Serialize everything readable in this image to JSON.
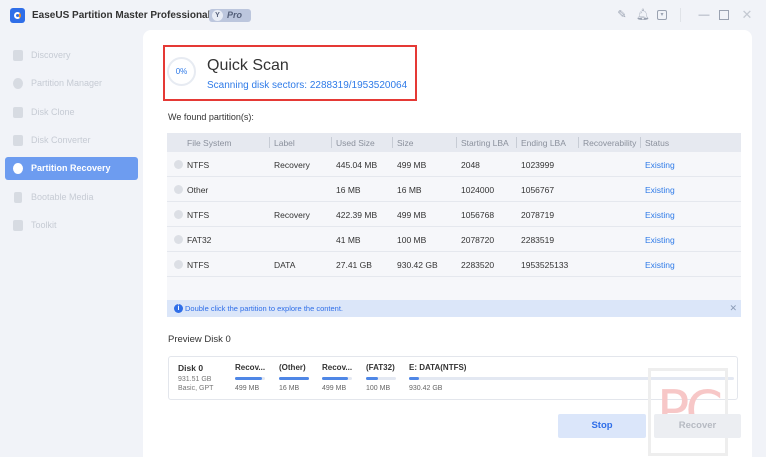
{
  "app": {
    "title": "EaseUS Partition Master Professional Edition",
    "badge": "Pro"
  },
  "titlebar_icons": [
    "feedback-icon",
    "bell-icon",
    "download-icon",
    "minimize-icon",
    "maximize-icon",
    "close-icon"
  ],
  "sidebar": {
    "items": [
      {
        "label": "Discovery",
        "active": false
      },
      {
        "label": "Partition Manager",
        "active": false
      },
      {
        "label": "Disk Clone",
        "active": false
      },
      {
        "label": "Disk Converter",
        "active": false
      },
      {
        "label": "Partition Recovery",
        "active": true
      },
      {
        "label": "Bootable Media",
        "active": false
      },
      {
        "label": "Toolkit",
        "active": false
      }
    ]
  },
  "scan": {
    "progress": "0%",
    "title": "Quick Scan",
    "status": "Scanning disk sectors: 2288319/1953520064"
  },
  "found_label": "We found partition(s):",
  "table": {
    "headers": [
      "File System",
      "Label",
      "Used Size",
      "Size",
      "Starting LBA",
      "Ending LBA",
      "Recoverability",
      "Status"
    ],
    "rows": [
      [
        "NTFS",
        "Recovery",
        "445.04 MB",
        "499 MB",
        "2048",
        "1023999",
        "",
        "Existing"
      ],
      [
        "Other",
        "",
        "16 MB",
        "16 MB",
        "1024000",
        "1056767",
        "",
        "Existing"
      ],
      [
        "NTFS",
        "Recovery",
        "422.39 MB",
        "499 MB",
        "1056768",
        "2078719",
        "",
        "Existing"
      ],
      [
        "FAT32",
        "",
        "41 MB",
        "100 MB",
        "2078720",
        "2283519",
        "",
        "Existing"
      ],
      [
        "NTFS",
        "DATA",
        "27.41 GB",
        "930.42 GB",
        "2283520",
        "1953525133",
        "",
        "Existing"
      ]
    ]
  },
  "info": "Double click the partition to explore the content.",
  "preview": {
    "title": "Preview Disk 0",
    "disk": {
      "name": "Disk 0",
      "size": "931.51 GB",
      "type": "Basic, GPT"
    },
    "partitions": [
      {
        "name": "Recov...",
        "size": "499 MB",
        "fill": 0.9
      },
      {
        "name": "(Other)",
        "size": "16 MB",
        "fill": 1.0
      },
      {
        "name": "Recov...",
        "size": "499 MB",
        "fill": 0.85
      },
      {
        "name": "(FAT32)",
        "size": "100 MB",
        "fill": 0.41
      },
      {
        "name": "E: DATA(NTFS)",
        "size": "930.42 GB",
        "fill": 0.03
      }
    ]
  },
  "buttons": {
    "stop": "Stop",
    "recover": "Recover"
  },
  "watermark": "PC",
  "colors": {
    "accent": "#2f7be8",
    "highlight": "#e53935",
    "sidebar_active": "#6d9cf0"
  }
}
